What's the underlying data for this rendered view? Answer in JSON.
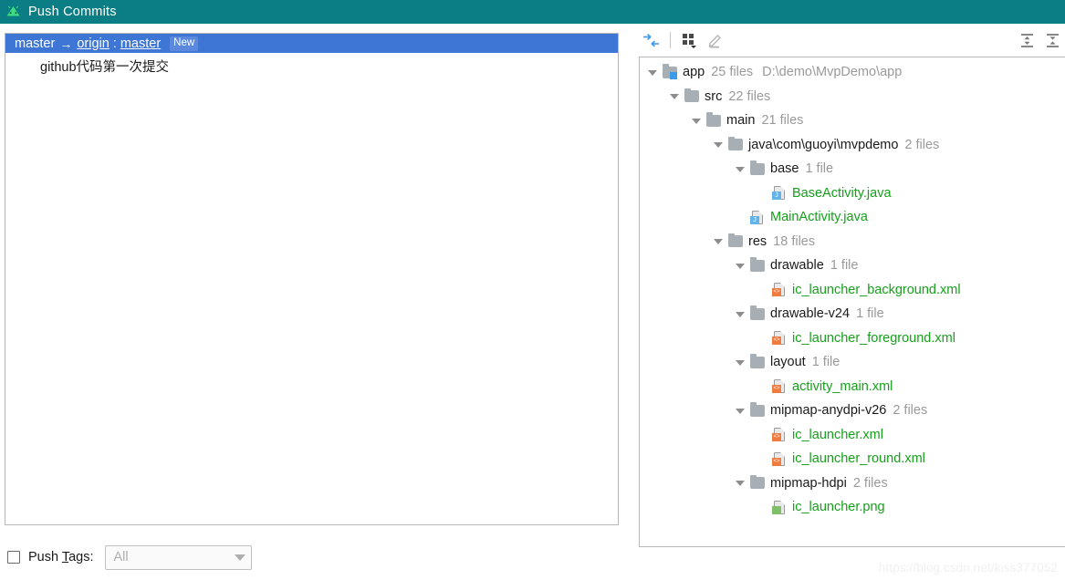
{
  "window": {
    "title": "Push Commits",
    "logo_icon": "android-studio-icon",
    "header_color": "#0a7e84"
  },
  "commits_panel": {
    "selection_color": "#3e76d6",
    "branch_row": {
      "local_branch": "master",
      "arrow": "→",
      "remote_name": "origin",
      "separator": ":",
      "remote_branch": "master",
      "badge": "New"
    },
    "commit_message": "github代码第一次提交"
  },
  "tree_toolbar": {
    "buttons": [
      {
        "name": "collapse-diff-icon",
        "icon": "arrows-collapse-horizontal"
      },
      {
        "name": "group-by-icon",
        "icon": "grid-dropdown"
      },
      {
        "name": "edit-source-icon",
        "icon": "pencil"
      }
    ],
    "right_buttons": [
      {
        "name": "expand-all-icon",
        "icon": "expand-all"
      },
      {
        "name": "collapse-all-icon",
        "icon": "collapse-all"
      }
    ]
  },
  "file_tree": {
    "added_color": "#15a01a",
    "nodes": [
      {
        "indent": 0,
        "type": "module",
        "label": "app",
        "count": "25 files",
        "path": "D:\\demo\\MvpDemo\\app",
        "expanded": true,
        "icon": "module-icon"
      },
      {
        "indent": 1,
        "type": "folder",
        "label": "src",
        "count": "22 files",
        "path": "",
        "expanded": true,
        "icon": "folder-icon"
      },
      {
        "indent": 2,
        "type": "folder",
        "label": "main",
        "count": "21 files",
        "path": "",
        "expanded": true,
        "icon": "folder-icon"
      },
      {
        "indent": 3,
        "type": "folder",
        "label": "java\\com\\guoyi\\mvpdemo",
        "count": "2 files",
        "path": "",
        "expanded": true,
        "icon": "folder-icon"
      },
      {
        "indent": 4,
        "type": "folder",
        "label": "base",
        "count": "1 file",
        "path": "",
        "expanded": true,
        "icon": "folder-icon"
      },
      {
        "indent": 5,
        "type": "java",
        "label": "BaseActivity.java",
        "count": "",
        "path": "",
        "expanded": false,
        "icon": "java-file-icon"
      },
      {
        "indent": 4,
        "type": "java",
        "label": "MainActivity.java",
        "count": "",
        "path": "",
        "expanded": false,
        "icon": "java-file-icon"
      },
      {
        "indent": 3,
        "type": "folder",
        "label": "res",
        "count": "18 files",
        "path": "",
        "expanded": true,
        "icon": "folder-icon"
      },
      {
        "indent": 4,
        "type": "folder",
        "label": "drawable",
        "count": "1 file",
        "path": "",
        "expanded": true,
        "icon": "folder-icon"
      },
      {
        "indent": 5,
        "type": "xml",
        "label": "ic_launcher_background.xml",
        "count": "",
        "path": "",
        "expanded": false,
        "icon": "xml-file-icon"
      },
      {
        "indent": 4,
        "type": "folder",
        "label": "drawable-v24",
        "count": "1 file",
        "path": "",
        "expanded": true,
        "icon": "folder-icon"
      },
      {
        "indent": 5,
        "type": "xml",
        "label": "ic_launcher_foreground.xml",
        "count": "",
        "path": "",
        "expanded": false,
        "icon": "xml-file-icon"
      },
      {
        "indent": 4,
        "type": "folder",
        "label": "layout",
        "count": "1 file",
        "path": "",
        "expanded": true,
        "icon": "folder-icon"
      },
      {
        "indent": 5,
        "type": "xml",
        "label": "activity_main.xml",
        "count": "",
        "path": "",
        "expanded": false,
        "icon": "xml-file-icon"
      },
      {
        "indent": 4,
        "type": "folder",
        "label": "mipmap-anydpi-v26",
        "count": "2 files",
        "path": "",
        "expanded": true,
        "icon": "folder-icon"
      },
      {
        "indent": 5,
        "type": "xml",
        "label": "ic_launcher.xml",
        "count": "",
        "path": "",
        "expanded": false,
        "icon": "xml-file-icon"
      },
      {
        "indent": 5,
        "type": "xml",
        "label": "ic_launcher_round.xml",
        "count": "",
        "path": "",
        "expanded": false,
        "icon": "xml-file-icon"
      },
      {
        "indent": 4,
        "type": "folder",
        "label": "mipmap-hdpi",
        "count": "2 files",
        "path": "",
        "expanded": true,
        "icon": "folder-icon"
      },
      {
        "indent": 5,
        "type": "png",
        "label": "ic_launcher.png",
        "count": "",
        "path": "",
        "expanded": false,
        "icon": "png-file-icon"
      }
    ]
  },
  "bottom_bar": {
    "push_tags_label_pre": "Push ",
    "push_tags_label_mnemonic": "T",
    "push_tags_label_post": "ags:",
    "push_tags_checked": false,
    "tags_combo_value": "All"
  },
  "watermark": "https://blog.csdn.net/kiss377052"
}
